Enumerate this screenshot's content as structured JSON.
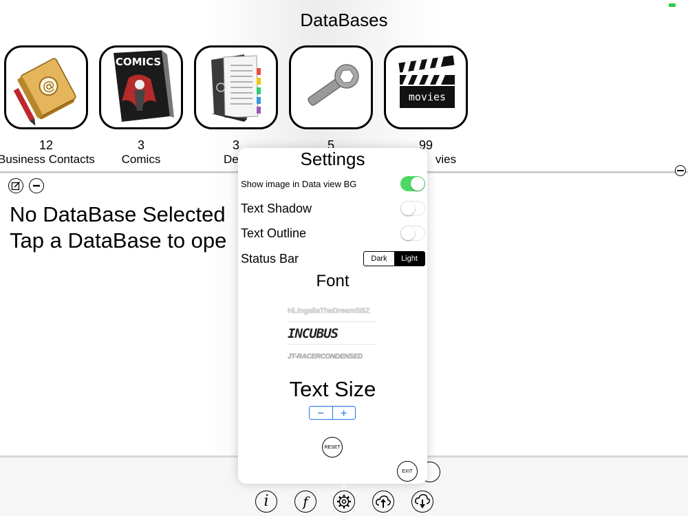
{
  "app": {
    "title": "DataBases"
  },
  "databases": [
    {
      "count": "12",
      "label": "Business Contacts",
      "icon": "address-book-icon"
    },
    {
      "count": "3",
      "label": "Comics",
      "icon": "comics-icon"
    },
    {
      "count": "3",
      "label": "Dent",
      "icon": "folder-binder-icon"
    },
    {
      "count": "5",
      "label": "",
      "icon": "wrench-icon"
    },
    {
      "count": "99",
      "label": "vies",
      "icon": "movies-clapperboard-icon"
    }
  ],
  "icon_text": {
    "comics": "COMICS",
    "movies": "movies",
    "at_symbol": "@"
  },
  "main": {
    "line1": "No DataBase Selected",
    "line2": "Tap a DataBase to ope"
  },
  "settings": {
    "title": "Settings",
    "show_image_label": "Show image in Data view BG",
    "show_image_on": true,
    "text_shadow_label": "Text Shadow",
    "text_shadow_on": false,
    "text_outline_label": "Text Outline",
    "text_outline_on": false,
    "status_bar_label": "Status Bar",
    "status_bar_options": [
      "Dark",
      "Light"
    ],
    "status_bar_selected": "Light",
    "font_heading": "Font",
    "fonts": [
      "HLIngaliaTheDreamSBZ",
      "INCUBUS",
      "JT-RACERCONDENSED"
    ],
    "text_size_heading": "Text Size",
    "decrease_label": "−",
    "increase_label": "+",
    "reset_label": "RESET",
    "exit_label": "EXIT"
  },
  "toolbar": {
    "info_glyph": "i",
    "font_glyph": "f",
    "icons": [
      "info-icon",
      "font-icon",
      "settings-gear-icon",
      "cloud-upload-icon",
      "cloud-download-icon"
    ]
  },
  "colors": {
    "toggle_on": "#4cd964",
    "stepper_accent": "#1a73e8",
    "status_indicator": "#2ecc40"
  }
}
